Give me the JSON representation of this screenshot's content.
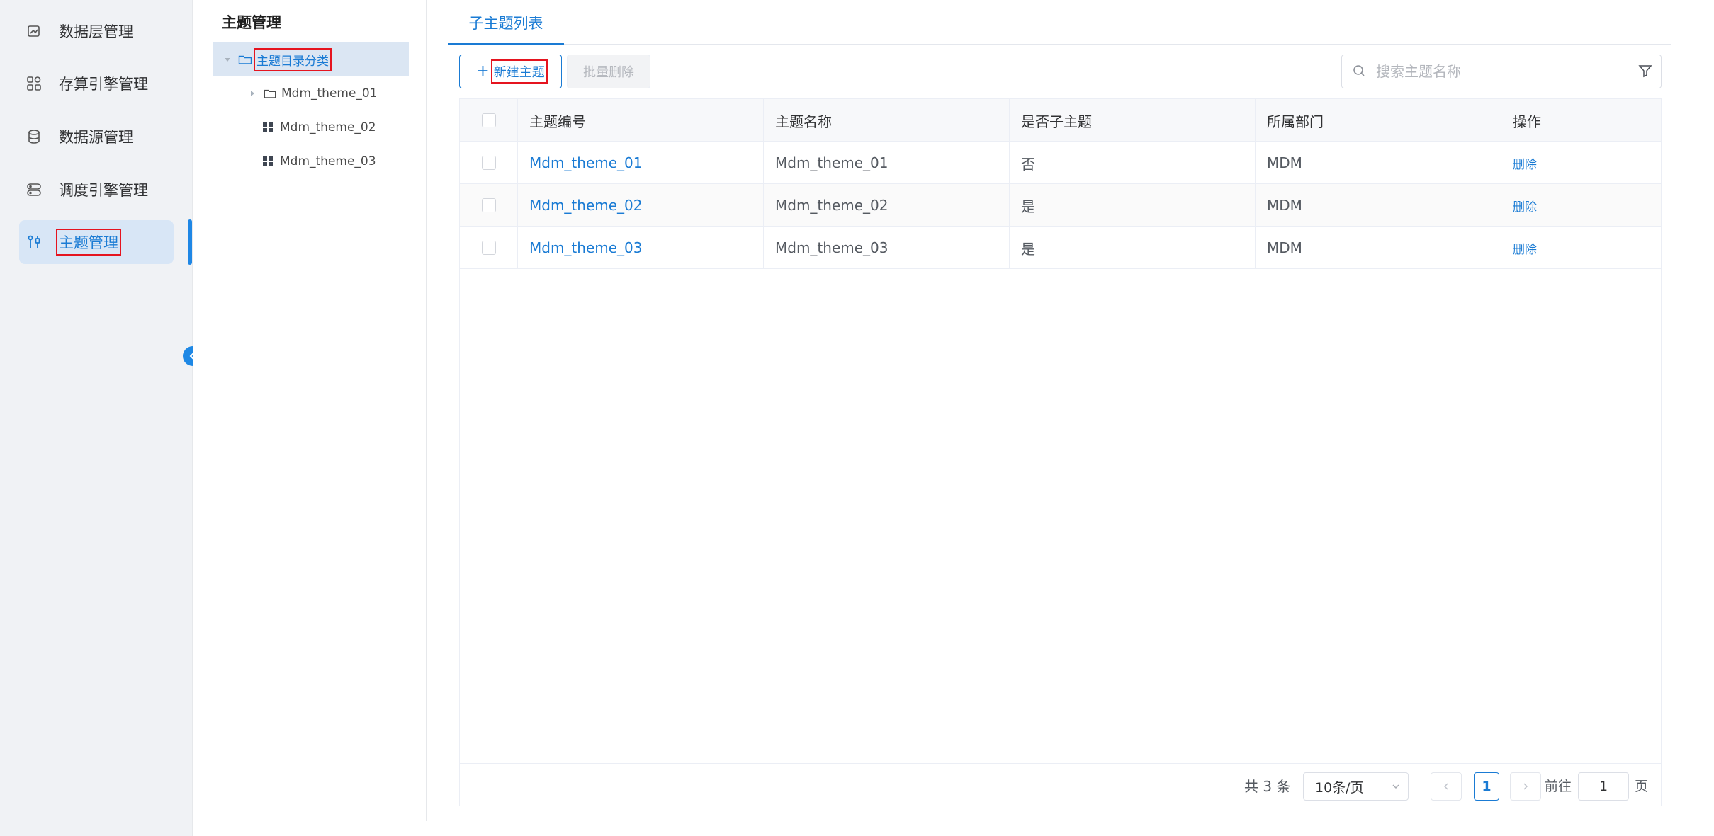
{
  "nav": {
    "items": [
      {
        "label": "数据层管理",
        "icon": "layers-icon"
      },
      {
        "label": "存算引擎管理",
        "icon": "grid-apps-icon"
      },
      {
        "label": "数据源管理",
        "icon": "database-icon"
      },
      {
        "label": "调度引擎管理",
        "icon": "server-icon"
      },
      {
        "label": "主题管理",
        "icon": "tools-icon",
        "active": true
      }
    ],
    "accent": "#1a7bd4",
    "active_bg": "#d8e6f6"
  },
  "tree": {
    "title": "主题管理",
    "root": "主题目录分类",
    "children": [
      "Mdm_theme_01",
      "Mdm_theme_02",
      "Mdm_theme_03"
    ]
  },
  "tabs": [
    {
      "label": "子主题列表",
      "active": true
    }
  ],
  "toolbar": {
    "new_label": "新建主题",
    "batch_delete_label": "批量删除",
    "search_placeholder": "搜索主题名称"
  },
  "table": {
    "columns": [
      "主题编号",
      "主题名称",
      "是否子主题",
      "所属部门",
      "操作"
    ],
    "rows": [
      {
        "id": "Mdm_theme_01",
        "name": "Mdm_theme_01",
        "is_sub": "否",
        "dept": "MDM",
        "action": "删除"
      },
      {
        "id": "Mdm_theme_02",
        "name": "Mdm_theme_02",
        "is_sub": "是",
        "dept": "MDM",
        "action": "删除"
      },
      {
        "id": "Mdm_theme_03",
        "name": "Mdm_theme_03",
        "is_sub": "是",
        "dept": "MDM",
        "action": "删除"
      }
    ]
  },
  "pagination": {
    "total": "共 3 条",
    "page_size": "10条/页",
    "current_page": "1",
    "goto_label": "前往",
    "goto_value": "1",
    "page_suffix": "页"
  }
}
